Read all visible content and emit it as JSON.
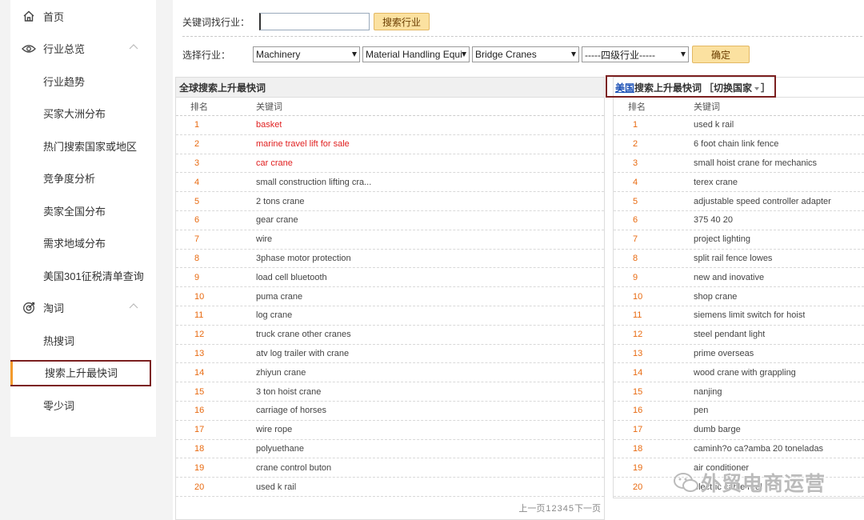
{
  "sidebar": {
    "home": "首页",
    "overview": {
      "label": "行业总览",
      "items": [
        "行业趋势",
        "买家大洲分布",
        "热门搜索国家或地区",
        "竞争度分析",
        "卖家全国分布",
        "需求地域分布",
        "美国301征税清单查询"
      ]
    },
    "words": {
      "label": "淘词",
      "items": [
        "热搜词",
        "搜索上升最快词",
        "零少词"
      ]
    }
  },
  "search": {
    "label": "关键词找行业：",
    "value": "",
    "button": "搜索行业"
  },
  "select": {
    "label": "选择行业：",
    "level1": "Machinery",
    "level2": "Material Handling Equi",
    "level3": "Bridge Cranes",
    "level4": "-----四级行业-----",
    "confirm": "确定"
  },
  "global": {
    "title": "全球搜索上升最快词",
    "col_rank": "排名",
    "col_keyword": "关键词",
    "rows": [
      {
        "rank": "1",
        "kw": "basket",
        "hot": true
      },
      {
        "rank": "2",
        "kw": "marine travel lift for sale",
        "hot": true
      },
      {
        "rank": "3",
        "kw": "car crane",
        "hot": true
      },
      {
        "rank": "4",
        "kw": "small construction lifting cra...",
        "hot": false
      },
      {
        "rank": "5",
        "kw": "2 tons crane",
        "hot": false
      },
      {
        "rank": "6",
        "kw": "gear crane",
        "hot": false
      },
      {
        "rank": "7",
        "kw": "wire",
        "hot": false
      },
      {
        "rank": "8",
        "kw": "3phase motor protection",
        "hot": false
      },
      {
        "rank": "9",
        "kw": "load cell bluetooth",
        "hot": false
      },
      {
        "rank": "10",
        "kw": "puma crane",
        "hot": false
      },
      {
        "rank": "11",
        "kw": "log crane",
        "hot": false
      },
      {
        "rank": "12",
        "kw": "truck crane other cranes",
        "hot": false
      },
      {
        "rank": "13",
        "kw": "atv log trailer with crane",
        "hot": false
      },
      {
        "rank": "14",
        "kw": "zhiyun crane",
        "hot": false
      },
      {
        "rank": "15",
        "kw": "3 ton hoist crane",
        "hot": false
      },
      {
        "rank": "16",
        "kw": "carriage of horses",
        "hot": false
      },
      {
        "rank": "17",
        "kw": "wire rope",
        "hot": false
      },
      {
        "rank": "18",
        "kw": "polyuethane",
        "hot": false
      },
      {
        "rank": "19",
        "kw": "crane control buton",
        "hot": false
      },
      {
        "rank": "20",
        "kw": "used k rail",
        "hot": false
      }
    ],
    "pager": {
      "prev": "上一页",
      "pages": [
        "1",
        "2",
        "3",
        "4",
        "5"
      ],
      "next": "下一页"
    }
  },
  "country": {
    "name": "美国",
    "title": "搜索上升最快词",
    "switch": "［切换国家",
    "switch_end": "］",
    "col_rank": "排名",
    "col_keyword": "关键词",
    "rows": [
      {
        "rank": "1",
        "kw": "used k rail"
      },
      {
        "rank": "2",
        "kw": "6 foot chain link fence"
      },
      {
        "rank": "3",
        "kw": "small hoist crane for mechanics"
      },
      {
        "rank": "4",
        "kw": "terex crane"
      },
      {
        "rank": "5",
        "kw": "adjustable speed controller adapter"
      },
      {
        "rank": "6",
        "kw": "375 40 20"
      },
      {
        "rank": "7",
        "kw": "project lighting"
      },
      {
        "rank": "8",
        "kw": "split rail fence lowes"
      },
      {
        "rank": "9",
        "kw": "new and inovative"
      },
      {
        "rank": "10",
        "kw": "shop crane"
      },
      {
        "rank": "11",
        "kw": "siemens limit switch for hoist"
      },
      {
        "rank": "12",
        "kw": "steel pendant light"
      },
      {
        "rank": "13",
        "kw": "prime overseas"
      },
      {
        "rank": "14",
        "kw": "wood crane with grappling"
      },
      {
        "rank": "15",
        "kw": "nanjing"
      },
      {
        "rank": "16",
        "kw": "pen"
      },
      {
        "rank": "17",
        "kw": "dumb barge"
      },
      {
        "rank": "18",
        "kw": "caminh?o ca?amba 20 toneladas"
      },
      {
        "rank": "19",
        "kw": "air conditioner"
      },
      {
        "rank": "20",
        "kw": "electric cable reel"
      }
    ]
  },
  "watermark": "外贸电商运营",
  "colors": {
    "accent": "#f39a2c",
    "highlight_border": "#7b1f1f",
    "rank": "#e86a10",
    "hot": "#e02020",
    "link": "#1a4fb5"
  }
}
